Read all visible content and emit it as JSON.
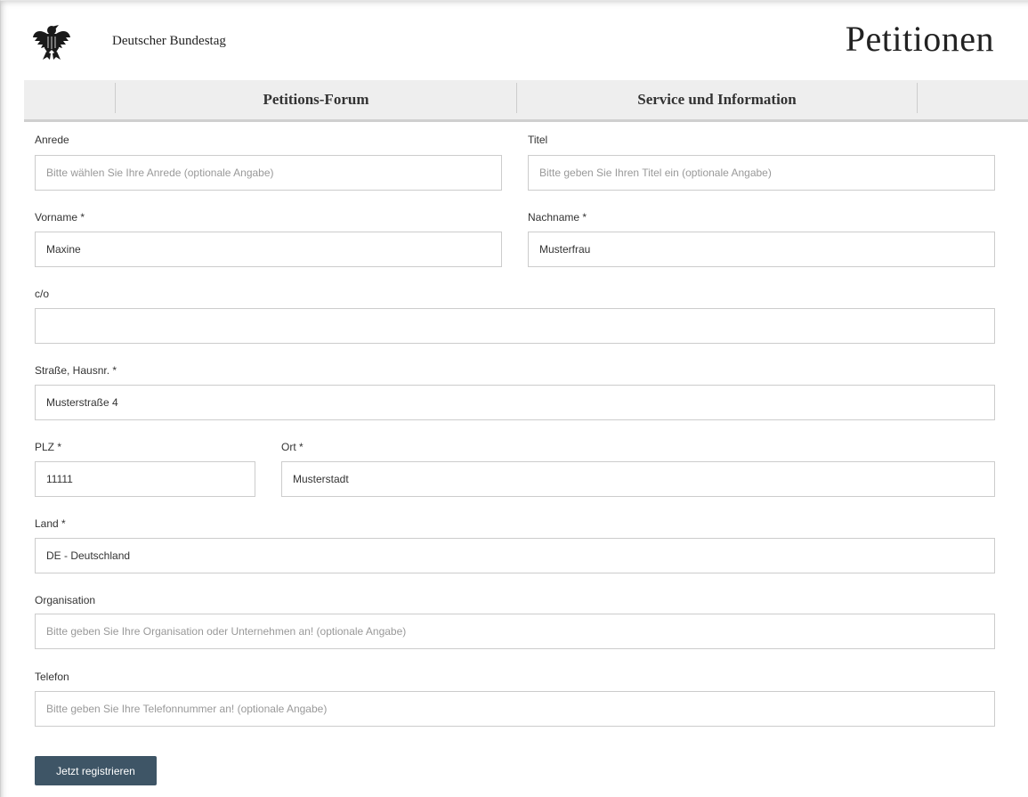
{
  "header": {
    "org_name": "Deutscher Bundestag",
    "site_title": "Petitionen",
    "logo_icon": "federal-eagle-icon"
  },
  "nav": {
    "tabs": [
      {
        "label": "Petitions-Forum"
      },
      {
        "label": "Service und Information"
      }
    ]
  },
  "form": {
    "anrede": {
      "label": "Anrede",
      "value": "",
      "placeholder": "Bitte wählen Sie Ihre Anrede (optionale Angabe)"
    },
    "titel": {
      "label": "Titel",
      "value": "",
      "placeholder": "Bitte geben Sie Ihren Titel ein (optionale Angabe)"
    },
    "vorname": {
      "label": "Vorname *",
      "value": "Maxine",
      "placeholder": ""
    },
    "nachname": {
      "label": "Nachname *",
      "value": "Musterfrau",
      "placeholder": ""
    },
    "co": {
      "label": "c/o",
      "value": "",
      "placeholder": ""
    },
    "strasse": {
      "label": "Straße, Hausnr. *",
      "value": "Musterstraße 4",
      "placeholder": ""
    },
    "plz": {
      "label": "PLZ *",
      "value": "11111",
      "placeholder": ""
    },
    "ort": {
      "label": "Ort *",
      "value": "Musterstadt",
      "placeholder": ""
    },
    "land": {
      "label": "Land *",
      "value": "DE - Deutschland",
      "placeholder": ""
    },
    "organisation": {
      "label": "Organisation",
      "value": "",
      "placeholder": "Bitte geben Sie Ihre Organisation oder Unternehmen an! (optionale Angabe)"
    },
    "telefon": {
      "label": "Telefon",
      "value": "",
      "placeholder": "Bitte geben Sie Ihre Telefonnummer an! (optionale Angabe)"
    },
    "submit_label": "Jetzt registrieren"
  },
  "colors": {
    "button_bg": "#3e5566",
    "nav_bg": "#eeeeee",
    "border": "#cccccc"
  }
}
